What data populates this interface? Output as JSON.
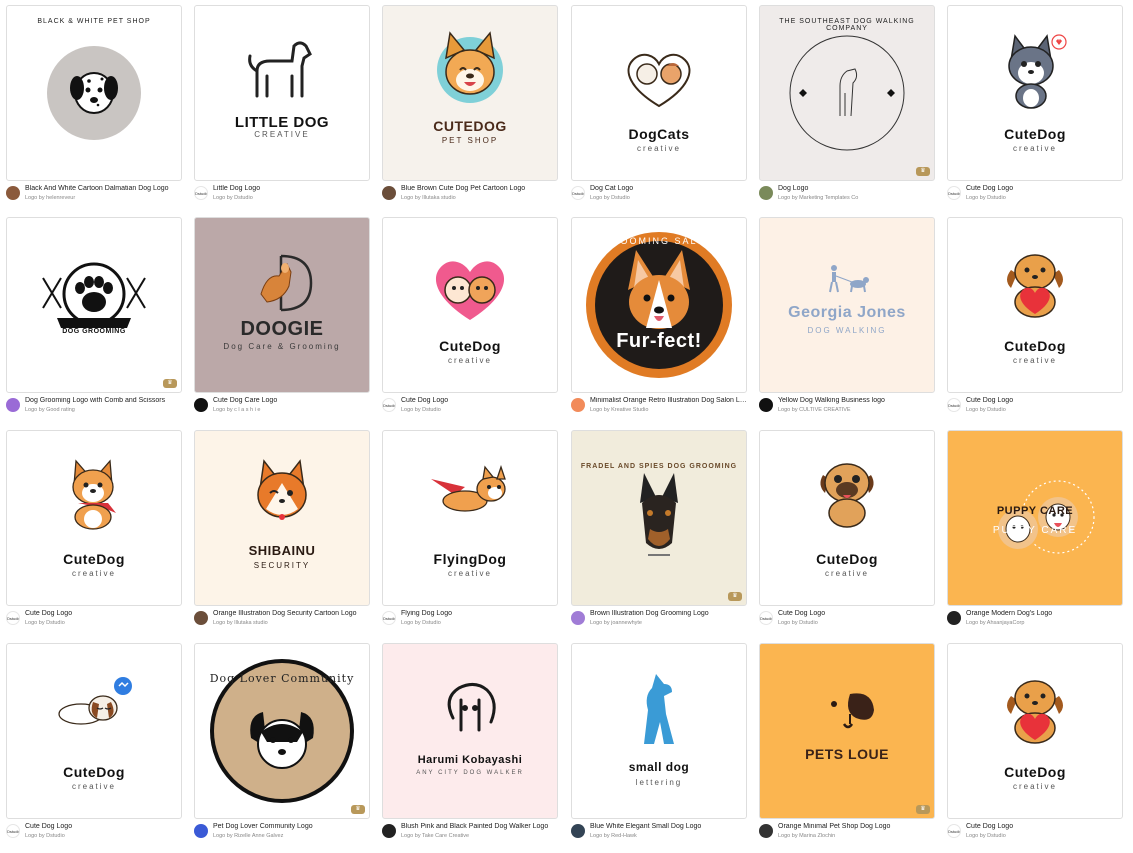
{
  "cards": [
    {
      "title": "Black And White Cartoon Dalmatian Dog Logo",
      "author": "Logo by helenreveur",
      "bg": "#ffffff",
      "avatar_bg": "#8b5a3c",
      "logo_main": "",
      "logo_sub": "",
      "ring_text": "BLACK & WHITE PET SHOP",
      "art": "dalmatian",
      "pro": false
    },
    {
      "title": "Little Dog Logo",
      "author": "Logo by Dstudio",
      "bg": "#ffffff",
      "avatar_bg": "#ffffff",
      "avatar_text": "Dstudio",
      "logo_main": "LITTLE DOG",
      "logo_sub": "CREATIVE",
      "art": "outline-dog",
      "pro": false
    },
    {
      "title": "Blue Brown Cute Dog Pet Cartoon Logo",
      "author": "Logo by Illutaka studio",
      "bg": "#f6f2ec",
      "avatar_bg": "#6b4e3a",
      "logo_main": "CUTEDOG",
      "logo_sub": "PET SHOP",
      "art": "frenchie",
      "pro": false
    },
    {
      "title": "Dog Cat Logo",
      "author": "Logo by Dstudio",
      "bg": "#ffffff",
      "avatar_bg": "#ffffff",
      "avatar_text": "Dstudio",
      "logo_main": "DogCats",
      "logo_sub": "creative",
      "art": "dogcat",
      "pro": false
    },
    {
      "title": "Dog Logo",
      "author": "Logo by Marketing Templates Co",
      "bg": "#efebea",
      "avatar_bg": "#7a8a5a",
      "logo_main": "",
      "logo_sub": "",
      "ring_text": "THE SOUTHEAST DOG WALKING COMPANY",
      "art": "ring-outline",
      "pro": true
    },
    {
      "title": "Cute Dog Logo",
      "author": "Logo by Dstudio",
      "bg": "#ffffff",
      "avatar_bg": "#ffffff",
      "avatar_text": "Dstudio",
      "logo_main": "CuteDog",
      "logo_sub": "creative",
      "art": "husky",
      "pro": false
    },
    {
      "title": "Dog Grooming Logo with Comb and Scissors",
      "author": "Logo by Good rating",
      "bg": "#ffffff",
      "avatar_bg": "#9a6bd6",
      "logo_main": "DOG GROOMING",
      "logo_sub": "",
      "art": "paw",
      "pro": true
    },
    {
      "title": "Cute Dog Care Logo",
      "author": "Logo by c l a s h i e",
      "bg": "#bba8a8",
      "avatar_bg": "#111111",
      "logo_main": "DOOGIE",
      "logo_sub": "Dog Care & Grooming",
      "art": "doogie",
      "pro": false
    },
    {
      "title": "Cute Dog Logo",
      "author": "Logo by Dstudio",
      "bg": "#ffffff",
      "avatar_bg": "#ffffff",
      "avatar_text": "Dstudio",
      "logo_main": "CuteDog",
      "logo_sub": "creative",
      "art": "heart-pups",
      "pro": false
    },
    {
      "title": "Minimalist Orange Retro Illustration Dog Salon Logo",
      "author": "Logo by Kreative Studio",
      "bg": "#ffffff",
      "avatar_bg": "#f28b5a",
      "logo_main": "Fur-fect!",
      "logo_sub": "GROOMING SALON",
      "art": "corgi-badge",
      "pro": false
    },
    {
      "title": "Yellow Dog Walking Business logo",
      "author": "Logo by CULTIVE CREATIVE",
      "bg": "#fdf1e6",
      "avatar_bg": "#111111",
      "logo_main": "Georgia Jones",
      "logo_sub": "DOG WALKING",
      "art": "walker",
      "pro": false
    },
    {
      "title": "Cute Dog Logo",
      "author": "Logo by Dstudio",
      "bg": "#ffffff",
      "avatar_bg": "#ffffff",
      "avatar_text": "Dstudio",
      "logo_main": "CuteDog",
      "logo_sub": "creative",
      "art": "heart-dog",
      "pro": false
    },
    {
      "title": "Cute Dog Logo",
      "author": "Logo by Dstudio",
      "bg": "#ffffff",
      "avatar_bg": "#ffffff",
      "avatar_text": "Dstudio",
      "logo_main": "CuteDog",
      "logo_sub": "creative",
      "art": "corgi-scarf",
      "pro": false
    },
    {
      "title": "Orange Illustration Dog Security Cartoon Logo",
      "author": "Logo by Illutaka studio",
      "bg": "#fdf4e8",
      "avatar_bg": "#6b4e3a",
      "logo_main": "SHIBAINU",
      "logo_sub": "SECURITY",
      "art": "shiba",
      "pro": false
    },
    {
      "title": "Flying Dog Logo",
      "author": "Logo by Dstudio",
      "bg": "#ffffff",
      "avatar_bg": "#ffffff",
      "avatar_text": "Dstudio",
      "logo_main": "FlyingDog",
      "logo_sub": "creative",
      "art": "flying",
      "pro": false
    },
    {
      "title": "Brown Illustration Dog Grooming Logo",
      "author": "Logo by joannewhyte",
      "bg": "#f1ecdc",
      "avatar_bg": "#a07cd6",
      "logo_main": "",
      "logo_sub": "",
      "ring_text": "FRADEL AND SPIES DOG GROOMING",
      "art": "dobermann",
      "pro": true
    },
    {
      "title": "Cute Dog Logo",
      "author": "Logo by Dstudio",
      "bg": "#ffffff",
      "avatar_bg": "#ffffff",
      "avatar_text": "Dstudio",
      "logo_main": "CuteDog",
      "logo_sub": "creative",
      "art": "pug",
      "pro": false
    },
    {
      "title": "Orange Modern Dog's Logo",
      "author": "Logo by AhsanjayaCorp",
      "bg": "#fbb550",
      "avatar_bg": "#222222",
      "logo_main": "PUPPY CARE",
      "logo_sub": "PUPPY CARE",
      "art": "puppycare",
      "pro": false
    },
    {
      "title": "Cute Dog Logo",
      "author": "Logo by Dstudio",
      "bg": "#ffffff",
      "avatar_bg": "#ffffff",
      "avatar_text": "Dstudio",
      "logo_main": "CuteDog",
      "logo_sub": "creative",
      "art": "sleepy",
      "pro": false
    },
    {
      "title": "Pet Dog Lover Community Logo",
      "author": "Logo by Rizelle Anne Galvez",
      "bg": "#ffffff",
      "avatar_bg": "#3a5ad6",
      "logo_main": "",
      "logo_sub": "",
      "ring_text": "Dog Lover Community",
      "art": "lover-ring",
      "pro": true
    },
    {
      "title": "Blush Pink and Black Painted Dog Walker Logo",
      "author": "Logo by Take Care Creative",
      "bg": "#fdebec",
      "avatar_bg": "#222222",
      "logo_main": "Harumi Kobayashi",
      "logo_sub": "ANY CITY DOG WALKER",
      "art": "painted",
      "pro": false
    },
    {
      "title": "Blue White Elegant Small Dog Logo",
      "author": "Logo by Red-Hawk",
      "bg": "#ffffff",
      "avatar_bg": "#334455",
      "logo_main": "small dog",
      "logo_sub": "lettering",
      "art": "small-dog",
      "pro": false
    },
    {
      "title": "Orange Minimal Pet Shop Dog Logo",
      "author": "Logo by Marina Zlochin",
      "bg": "#fbb550",
      "avatar_bg": "#333333",
      "logo_main": "PETS LOUE",
      "logo_sub": "",
      "art": "minimal-face",
      "pro": true
    },
    {
      "title": "Cute Dog Logo",
      "author": "Logo by Dstudio",
      "bg": "#ffffff",
      "avatar_bg": "#ffffff",
      "avatar_text": "Dstudio",
      "logo_main": "CuteDog",
      "logo_sub": "creative",
      "art": "heart-dog",
      "pro": false
    }
  ],
  "pro_badge_glyph": "♛"
}
